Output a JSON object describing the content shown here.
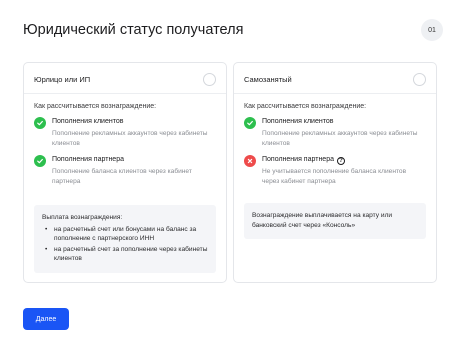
{
  "header": {
    "title": "Юридический статус получателя",
    "step": "01"
  },
  "cards": [
    {
      "title": "Юрлицо или ИП",
      "section_label": "Как рассчитывается вознаграждение:",
      "features": [
        {
          "icon": "check-icon",
          "title": "Пополнения клиентов",
          "desc": "Пополнение рекламных аккаунтов через кабинеты клиентов"
        },
        {
          "icon": "check-icon",
          "title": "Пополнения партнера",
          "desc": "Пополнение баланса клиентов через кабинет партнера"
        }
      ],
      "note": {
        "heading": "Выплата вознаграждения:",
        "items": [
          "на расчетный счет или бонусами на баланс за пополнение с партнерского ИНН",
          "на расчетный счет за пополнение через кабинеты клиентов"
        ]
      }
    },
    {
      "title": "Самозанятый",
      "section_label": "Как рассчитывается вознаграждение:",
      "features": [
        {
          "icon": "check-icon",
          "title": "Пополнения клиентов",
          "desc": "Пополнение рекламных аккаунтов через кабинеты клиентов"
        },
        {
          "icon": "cross-icon",
          "title": "Пополнения партнера",
          "help": "?",
          "desc": "Не учитывается пополнение баланса клиентов через кабинет партнера"
        }
      ],
      "note": {
        "text": "Вознаграждение выплачивается на карту или банковский счет через «Консоль»"
      }
    }
  ],
  "footer": {
    "next_label": "Далее"
  },
  "colors": {
    "accent": "#1a55f5",
    "success": "#2dbf4e",
    "error": "#ee4b4b"
  }
}
